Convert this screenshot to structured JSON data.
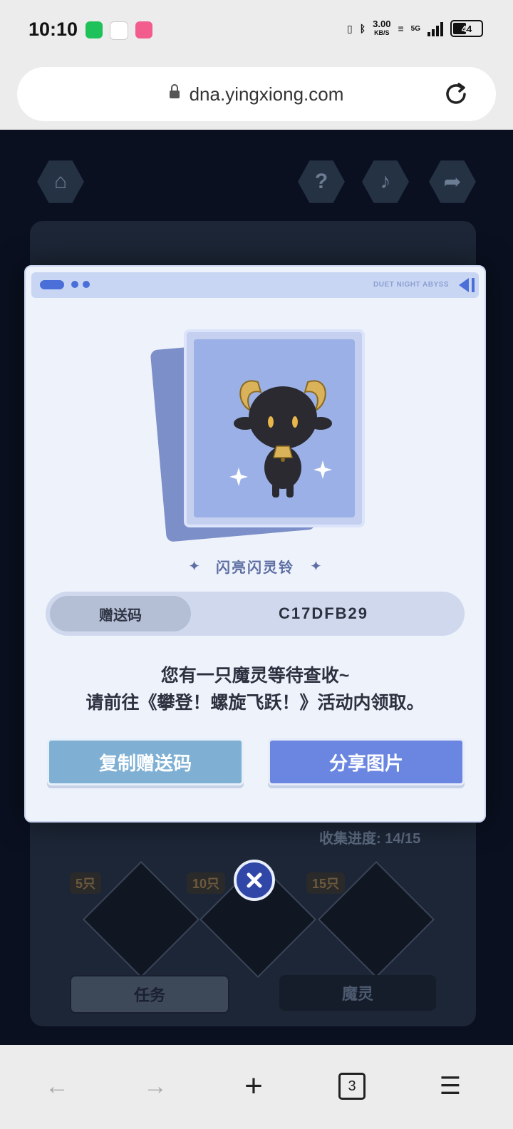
{
  "status_bar": {
    "time": "10:10",
    "net_speed_value": "3.00",
    "net_speed_unit": "KB/S",
    "network": "5G",
    "battery": "44"
  },
  "browser": {
    "url": "dna.yingxiong.com",
    "tab_count": "3"
  },
  "page_bg": {
    "progress": "收集进度: 14/15",
    "milestones": [
      "5只",
      "10只",
      "15只"
    ],
    "tabs": [
      "任务",
      "魔灵"
    ]
  },
  "modal": {
    "header_brand": "DUET NIGHT ABYSS",
    "pet_name": "闪亮闪灵铃",
    "code_label": "赠送码",
    "code_value": "C17DFB29",
    "message_line1": "您有一只魔灵等待查收~",
    "message_line2": "请前往《攀登！螺旋飞跃！》活动内领取。",
    "copy_button": "复制赠送码",
    "share_button": "分享图片"
  },
  "colors": {
    "accent": "#6a86e0",
    "copy_button": "#7fb0d4",
    "close_button": "#3047a8"
  }
}
